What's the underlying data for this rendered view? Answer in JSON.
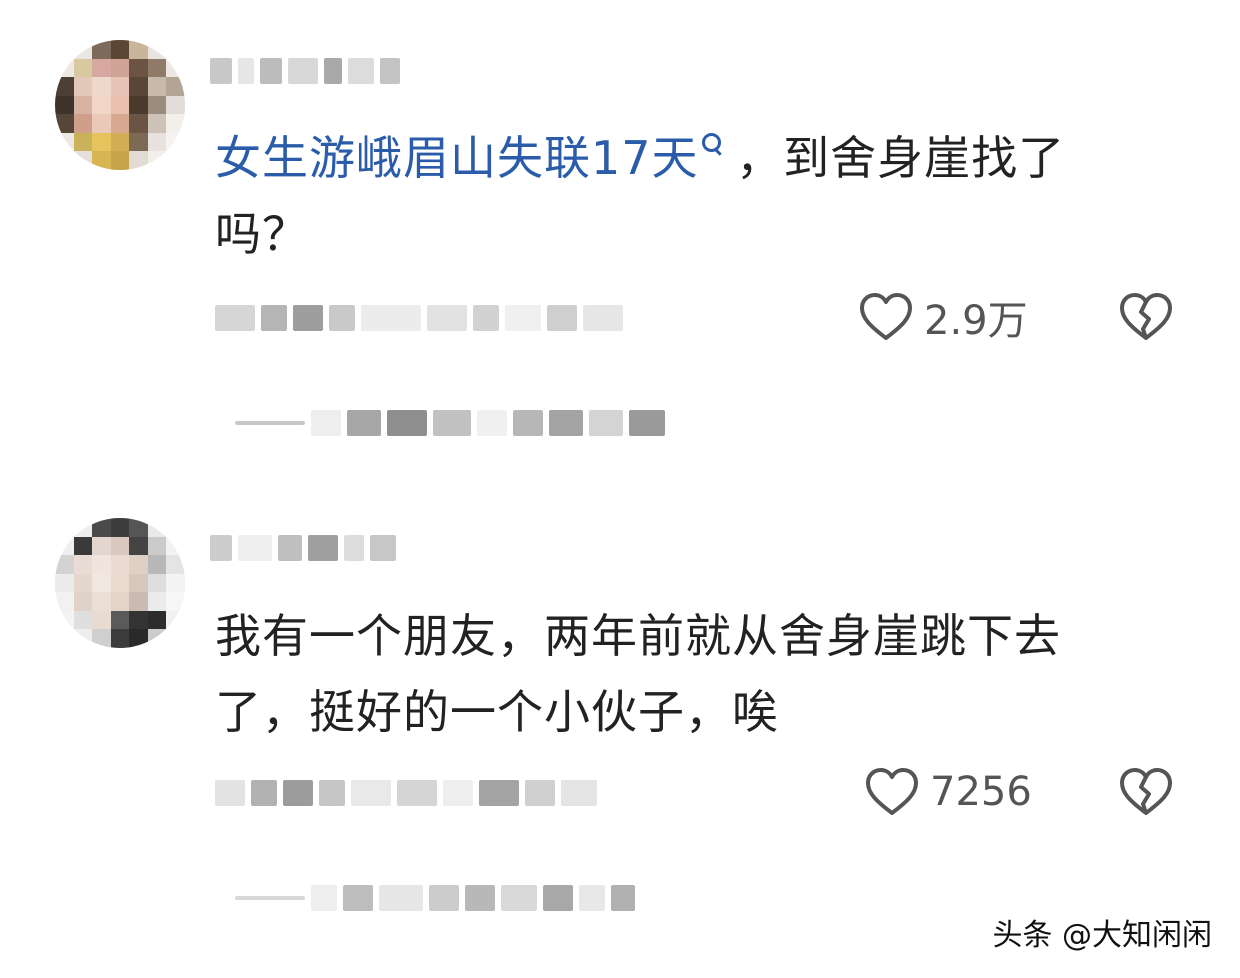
{
  "comments": [
    {
      "text_link": "女生游峨眉山失联17天",
      "text_rest_line1": "，到舍身崖找了",
      "text_line2": "吗？",
      "likes": "2.9万"
    },
    {
      "text_line1": "我有一个朋友，两年前就从舍身崖跳下去",
      "text_line2": "了，挺好的一个小伙子，唉",
      "likes": "7256"
    }
  ],
  "icons": {
    "like": "heart-outline-icon",
    "dislike": "broken-heart-icon",
    "search": "search-icon"
  },
  "watermark": "头条 @大知闲闲",
  "colors": {
    "link": "#2a5caa",
    "text": "#222222",
    "meta": "#555555"
  }
}
